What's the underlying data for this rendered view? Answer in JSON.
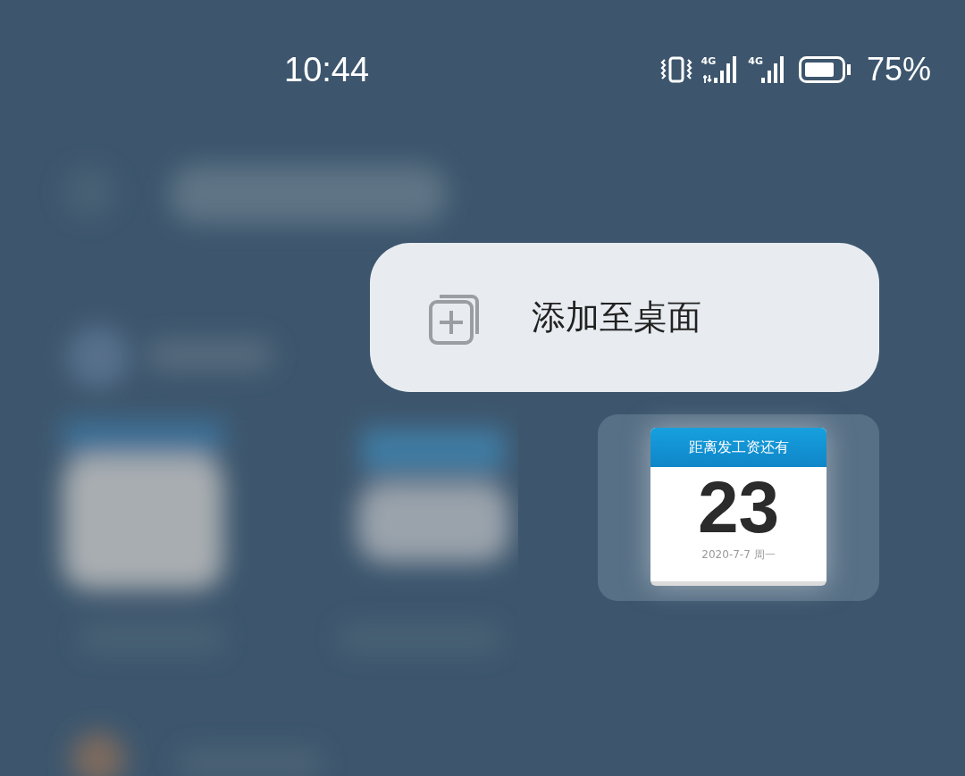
{
  "status_bar": {
    "time": "10:44",
    "networks": [
      {
        "label": "4G",
        "data_arrows": true
      },
      {
        "label": "4G",
        "data_arrows": false
      }
    ],
    "battery": {
      "reading": "75%"
    }
  },
  "menu": {
    "items": [
      {
        "label": "添加至桌面"
      }
    ]
  },
  "widget": {
    "header": "距离发工资还有",
    "count": "23",
    "date": "2020-7-7 周一"
  }
}
